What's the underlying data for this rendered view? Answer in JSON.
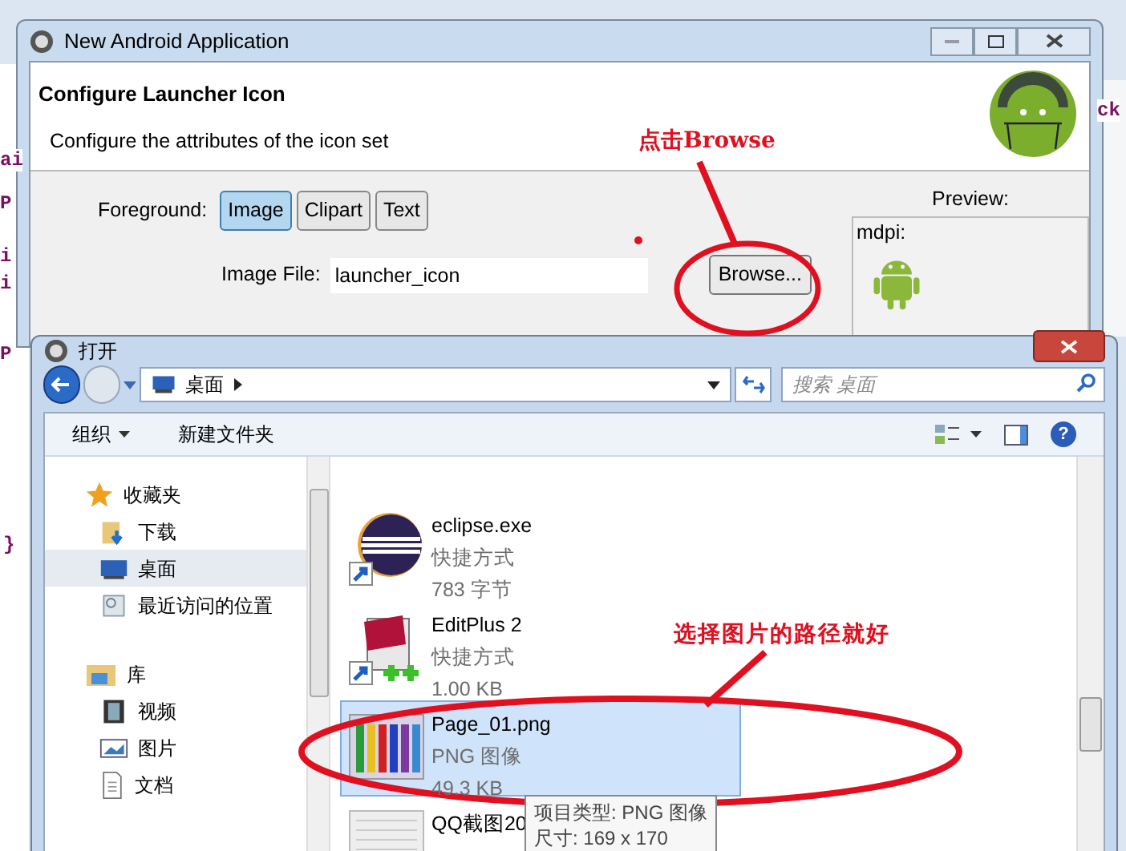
{
  "background_fragments": [
    "ai",
    "P",
    "i",
    "i",
    "P",
    "}",
    "ck"
  ],
  "wizard": {
    "title": "New Android Application",
    "heading": "Configure Launcher Icon",
    "description": "Configure the attributes of the icon set",
    "foreground_label": "Foreground:",
    "foreground_options": [
      {
        "label": "Image",
        "selected": true
      },
      {
        "label": "Clipart",
        "selected": false
      },
      {
        "label": "Text",
        "selected": false
      }
    ],
    "image_file_label": "Image File:",
    "image_file_value": "launcher_icon",
    "browse_button": "Browse...",
    "preview_label": "Preview:",
    "preview_density": "mdpi:"
  },
  "open_dialog": {
    "title": "打开",
    "breadcrumb": "桌面",
    "search_placeholder": "搜索 桌面",
    "organize": "组织",
    "new_folder": "新建文件夹",
    "nav": [
      {
        "label": "收藏夹",
        "kind": "favorites",
        "selected": false,
        "children": [
          {
            "label": "下载",
            "kind": "downloads",
            "selected": false
          },
          {
            "label": "桌面",
            "kind": "desktop",
            "selected": true
          },
          {
            "label": "最近访问的位置",
            "kind": "recent",
            "selected": false
          }
        ]
      },
      {
        "label": "库",
        "kind": "libraries",
        "selected": false,
        "children": [
          {
            "label": "视频",
            "kind": "videos",
            "selected": false
          },
          {
            "label": "图片",
            "kind": "pictures",
            "selected": false
          },
          {
            "label": "文档",
            "kind": "documents",
            "selected": false
          }
        ]
      }
    ],
    "files": [
      {
        "name": "eclipse.exe",
        "type": "快捷方式",
        "size": "783 字节",
        "kind": "eclipse",
        "selected": false
      },
      {
        "name": "EditPlus 2",
        "type": "快捷方式",
        "size": "1.00 KB",
        "kind": "editplus",
        "selected": false
      },
      {
        "name": "Page_01.png",
        "type": "PNG 图像",
        "size": "49.3 KB",
        "kind": "image",
        "selected": true
      },
      {
        "name": "QQ截图20",
        "kind": "screenshot",
        "selected": false
      }
    ],
    "help_glyph": "?",
    "tooltip": [
      "项目类型: PNG 图像",
      "尺寸: 169 x 170"
    ]
  },
  "annotations": [
    "点击Browse",
    "选择图片的路径就好"
  ]
}
